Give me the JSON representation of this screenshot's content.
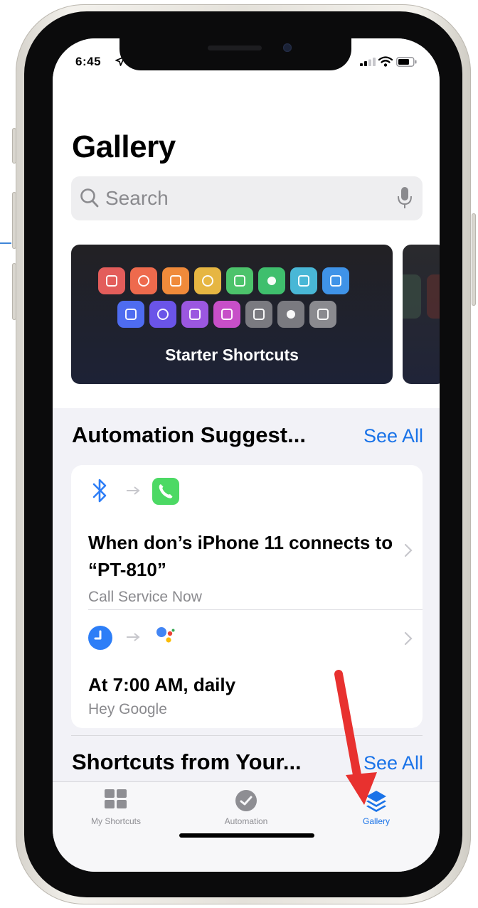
{
  "status_bar": {
    "time": "6:45"
  },
  "page": {
    "title": "Gallery"
  },
  "search": {
    "placeholder": "Search"
  },
  "banner": {
    "label": "Starter Shortcuts",
    "icon_row_1": [
      "#e35d5b",
      "#ee6a4d",
      "#f08a3a",
      "#e6b642",
      "#4cc36b",
      "#3fbf6d",
      "#49b7d6",
      "#3f93e8"
    ],
    "icon_row_2": [
      "#4e6cf0",
      "#6a54e8",
      "#9b57e0",
      "#c74fc8",
      "#7a7a80",
      "#7a7a80",
      "#8a8a8f"
    ]
  },
  "automation_section": {
    "title": "Automation Suggest...",
    "see_all": "See All",
    "suggestions": [
      {
        "trigger_icon": "bluetooth-icon",
        "action_icon": "phone-icon",
        "title": "When don’s iPhone 11 connects to “PT-810”",
        "subtitle": "Call Service Now"
      },
      {
        "trigger_icon": "clock-icon",
        "action_icon": "google-assistant-icon",
        "title": "At 7:00 AM, daily",
        "subtitle": "Hey Google"
      }
    ]
  },
  "shortcuts_section": {
    "title": "Shortcuts from Your...",
    "see_all": "See All"
  },
  "tab_bar": {
    "tabs": [
      {
        "label": "My Shortcuts",
        "icon": "grid-icon",
        "active": false
      },
      {
        "label": "Automation",
        "icon": "automation-clock-icon",
        "active": false
      },
      {
        "label": "Gallery",
        "icon": "layers-icon",
        "active": true
      }
    ]
  },
  "colors": {
    "accent": "#1a73e8",
    "annotation_arrow": "#e8312f"
  }
}
